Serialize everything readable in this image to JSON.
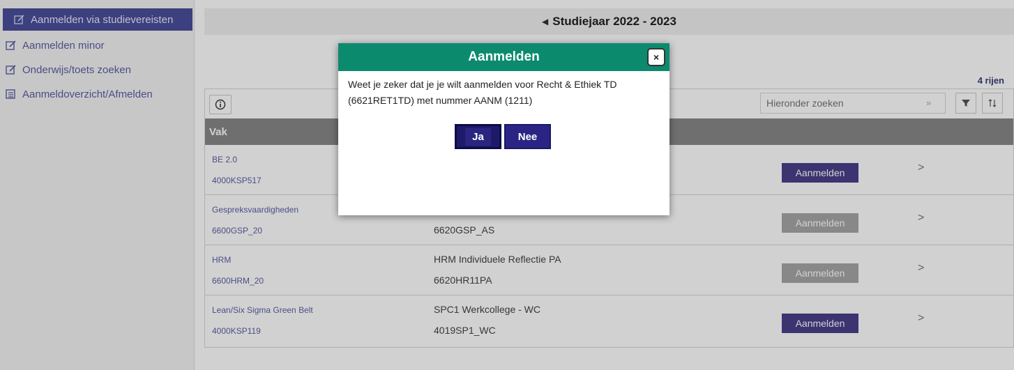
{
  "sidebar": {
    "items": [
      {
        "label": "Aanmelden via studievereisten",
        "icon": "edit-icon"
      },
      {
        "label": "Aanmelden minor",
        "icon": "edit-icon"
      },
      {
        "label": "Onderwijs/toets zoeken",
        "icon": "edit-icon"
      },
      {
        "label": "Aanmeldoverzicht/Afmelden",
        "icon": "list-icon"
      }
    ]
  },
  "header": {
    "year_label": "Studiejaar 2022 - 2023",
    "prev_icon": "triangle-left-icon"
  },
  "table": {
    "row_count": "4 rijen",
    "search_placeholder": "Hieronder zoeken",
    "column_header": "Vak",
    "rows": [
      {
        "title": "BE 2.0",
        "code": "4000KSP517",
        "detail_title": "",
        "detail_code": "",
        "action": "Aanmelden",
        "enabled": true
      },
      {
        "title": "Gespreksvaardigheden",
        "code": "6600GSP_20",
        "detail_title": "",
        "detail_code": "6620GSP_AS",
        "action": "Aanmelden",
        "enabled": false
      },
      {
        "title": "HRM",
        "code": "6600HRM_20",
        "detail_title": "HRM Individuele Reflectie PA",
        "detail_code": "6620HR11PA",
        "action": "Aanmelden",
        "enabled": false
      },
      {
        "title": "Lean/Six Sigma Green Belt",
        "code": "4000KSP119",
        "detail_title": "SPC1 Werkcollege - WC",
        "detail_code": "4019SP1_WC",
        "action": "Aanmelden",
        "enabled": true
      }
    ]
  },
  "modal": {
    "title": "Aanmelden",
    "message_line1": "Weet je zeker dat je je wilt aanmelden voor  Recht & Ethiek TD",
    "message_line2": "(6621RET1TD) met nummer AANM (1211)",
    "yes_label": "Ja",
    "no_label": "Nee",
    "close_label": "×"
  },
  "colors": {
    "accent": "#4a4f9a",
    "modal_header": "#0b8a6e",
    "button_enabled": "#4a3f8a",
    "button_disabled": "#a6a6a6"
  }
}
